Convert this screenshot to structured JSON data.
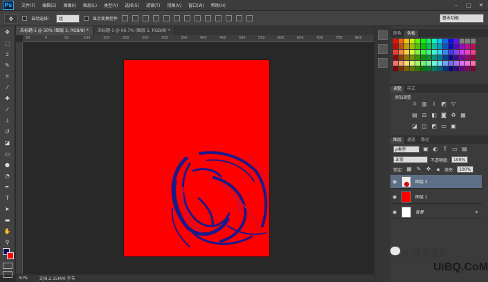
{
  "menu": {
    "logo": "Ps",
    "items": [
      "文件(F)",
      "编辑(E)",
      "图像(I)",
      "图层(L)",
      "类型(Y)",
      "选择(S)",
      "滤镜(T)",
      "视图(V)",
      "窗口(W)",
      "帮助(H)"
    ]
  },
  "options": {
    "auto_select_label": "自动选择：",
    "auto_select_value": "组",
    "show_transform_label": "显示变换控件",
    "workspace": "基本功能"
  },
  "tabs": [
    {
      "label": "未标题-1 @ 50% (图层 2, RGB/8) *"
    },
    {
      "label": "未标题-1 @ 66.7% (图层 1, RGB/8) *"
    }
  ],
  "ruler_ticks": [
    "50",
    "0",
    "50",
    "100",
    "150",
    "200",
    "250",
    "300",
    "350",
    "400",
    "450",
    "500",
    "550",
    "600",
    "650",
    "700",
    "750",
    "800"
  ],
  "status": {
    "zoom": "50%",
    "doc": "文档:2.15M/0 字节"
  },
  "panels": {
    "color_tab": "颜色",
    "swatches_tab": "色板",
    "adjust_tab": "调整",
    "style_tab": "样式",
    "add_adjust": "添加调整",
    "layers_tab": "图层",
    "channels_tab": "通道",
    "paths_tab": "路径",
    "kind": "ρ类型",
    "blend_mode": "正常",
    "opacity_label": "不透明度:",
    "opacity_value": "100%",
    "lock_label": "锁定:",
    "fill_label": "填充:",
    "fill_value": "100%",
    "layers": [
      {
        "name": "图层 2"
      },
      {
        "name": "图层 1"
      },
      {
        "name": "背景"
      }
    ]
  },
  "watermark": {
    "text": "小钱学设计",
    "logo": "UiBQ.CoM"
  },
  "colors": {
    "canvas_red": "#ff0000",
    "swirl_blue": "#1a1a8c",
    "foreground": "#0b0b5a",
    "background": "#ff0000"
  }
}
